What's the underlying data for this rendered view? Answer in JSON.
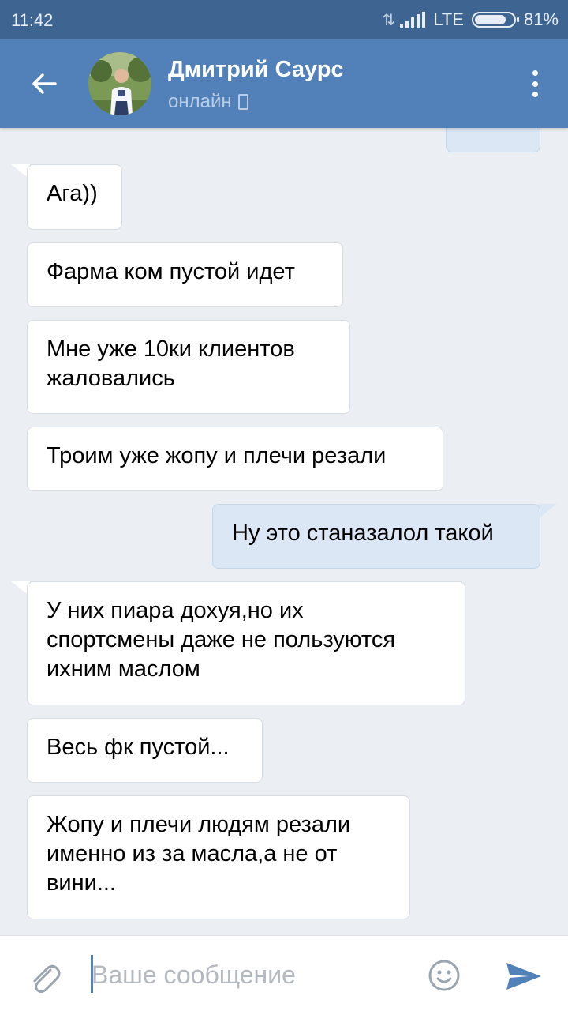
{
  "status_bar": {
    "time": "11:42",
    "network": "LTE",
    "battery": "81%",
    "battery_level": 0.81
  },
  "header": {
    "contact_name": "Дмитрий Саурс",
    "contact_status": "онлайн"
  },
  "messages": [
    {
      "direction": "in",
      "lines": [
        "Ага))"
      ]
    },
    {
      "direction": "in",
      "lines": [
        "Фарма ком пустой идет"
      ]
    },
    {
      "direction": "in",
      "lines": [
        "Мне уже 10ки клиентов",
        "жаловались"
      ]
    },
    {
      "direction": "in",
      "lines": [
        "Троим уже жопу и плечи резали"
      ]
    },
    {
      "direction": "out",
      "lines": [
        "Ну это станазалол такой"
      ]
    },
    {
      "direction": "in",
      "lines": [
        "У них пиара дохуя,но их",
        "спортсмены даже не пользуются",
        "ихним маслом"
      ]
    },
    {
      "direction": "in",
      "lines": [
        "Весь фк пустой..."
      ]
    },
    {
      "direction": "in",
      "lines": [
        "Жопу и плечи людям резали",
        "именно из за масла,а не от",
        "вини..."
      ]
    }
  ],
  "composer": {
    "placeholder": "Ваше сообщение",
    "value": ""
  },
  "colors": {
    "header": "#5181b8",
    "status_bar": "#3e6592",
    "background": "#ebeff3",
    "incoming": "#ffffff",
    "outgoing": "#dce7f5"
  }
}
